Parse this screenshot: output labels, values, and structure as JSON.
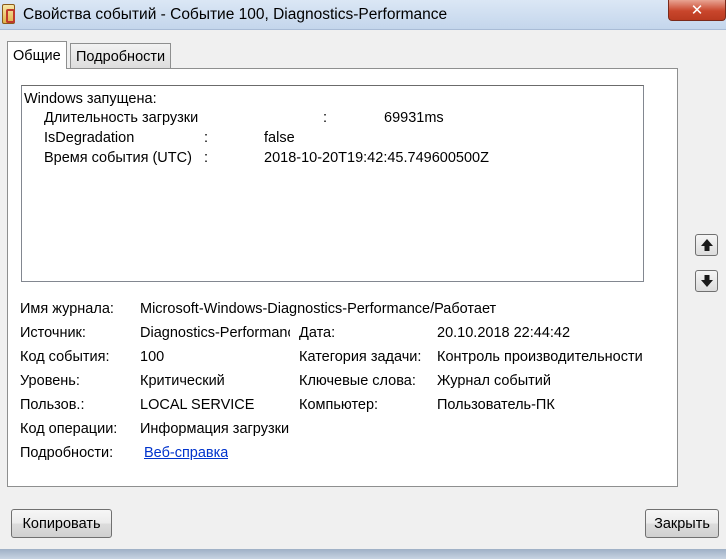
{
  "window": {
    "title": "Свойства событий - Событие 100, Diagnostics-Performance",
    "close_glyph": "✕"
  },
  "tabs": [
    {
      "label": "Общие",
      "active": true
    },
    {
      "label": "Подробности",
      "active": false
    }
  ],
  "description": {
    "heading": "Windows запущена:",
    "rows": [
      {
        "key": "Длительность загрузки",
        "sep": ":",
        "value": "69931ms"
      },
      {
        "key": "IsDegradation",
        "sep": ":",
        "value": "false"
      },
      {
        "key": "Время события (UTC)",
        "sep": ":",
        "value": "2018-10-20T19:42:45.749600500Z"
      }
    ]
  },
  "fields": {
    "log_name": {
      "label": "Имя журнала:",
      "value": "Microsoft-Windows-Diagnostics-Performance/Работает"
    },
    "source": {
      "label": "Источник:",
      "value": "Diagnostics-Performance"
    },
    "date": {
      "label": "Дата:",
      "value": "20.10.2018 22:44:42"
    },
    "event_id": {
      "label": "Код события:",
      "value": "100"
    },
    "task_category": {
      "label": "Категория задачи:",
      "value": "Контроль производительности"
    },
    "level": {
      "label": "Уровень:",
      "value": "Критический"
    },
    "keywords": {
      "label": "Ключевые слова:",
      "value": "Журнал событий"
    },
    "user": {
      "label": "Пользов.:",
      "value": "LOCAL SERVICE"
    },
    "computer": {
      "label": "Компьютер:",
      "value": "Пользователь-ПК"
    },
    "opcode": {
      "label": "Код операции:",
      "value": "Информация загрузки"
    },
    "more_info": {
      "label": "Подробности:",
      "link": "Веб-справка"
    }
  },
  "buttons": {
    "copy": "Копировать",
    "close": "Закрыть"
  },
  "icons": {
    "app": "event-viewer-icon",
    "up": "arrow-up-icon",
    "down": "arrow-down-icon"
  }
}
